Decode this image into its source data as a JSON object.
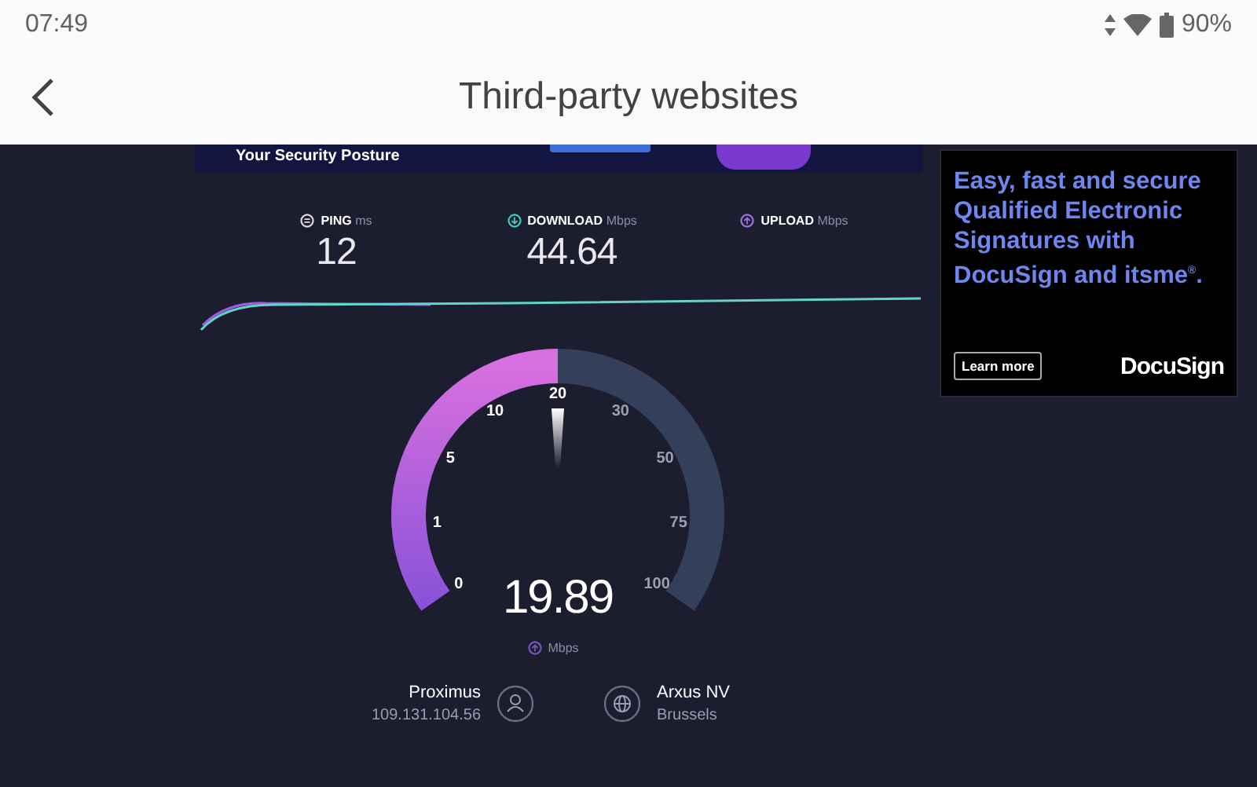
{
  "status_bar": {
    "time": "07:49",
    "battery": "90%"
  },
  "app_bar": {
    "title": "Third-party websites"
  },
  "banner": {
    "text": "Your Security Posture"
  },
  "metrics": [
    {
      "kind": "ping",
      "label": "PING",
      "unit": "ms",
      "value": "12"
    },
    {
      "kind": "download",
      "label": "DOWNLOAD",
      "unit": "Mbps",
      "value": "44.64"
    },
    {
      "kind": "upload",
      "label": "UPLOAD",
      "unit": "Mbps"
    }
  ],
  "gauge": {
    "level": 0.5,
    "ticks": [
      "0",
      "1",
      "5",
      "10",
      "20",
      "30",
      "50",
      "75",
      "100"
    ],
    "value": "19.89",
    "unit": "Mbps"
  },
  "server": {
    "provider": "Proximus",
    "ip": "109.131.104.56",
    "host": "Arxus NV",
    "location": "Brussels"
  },
  "ad": {
    "headline": "Easy, fast and secure Qualified Electronic Signatures with DocuSign and itsme$^{®}$.",
    "button": "Learn more",
    "brand": "DocuSign"
  }
}
